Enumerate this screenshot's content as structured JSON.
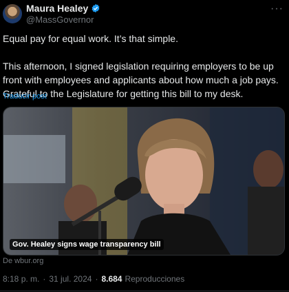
{
  "author": {
    "display_name": "Maura Healey",
    "handle": "@MassGovernor",
    "avatar_icon": "avatar-image",
    "verified_icon": "verified-badge-icon",
    "verified_color": "#1d9bf0"
  },
  "more_icon": "more-options-icon",
  "post": {
    "line1": "Equal pay for equal work. It’s that simple.",
    "line2": "This afternoon, I signed legislation requiring employers to be up front with employees and applicants about how much a job pays. Grateful to the Legislature for getting this bill to my desk."
  },
  "translate_label": "Traducir post",
  "media": {
    "caption": "Gov. Healey signs wage transparency bill",
    "source": "De wbur.org"
  },
  "meta": {
    "time": "8:18 p. m.",
    "separator": "·",
    "date": "31 jul. 2024",
    "views_count": "8.684",
    "views_label": "Reproducciones"
  },
  "colors": {
    "background": "#000000",
    "text": "#e7e9ea",
    "secondary": "#71767b",
    "accent": "#1d9bf0"
  }
}
